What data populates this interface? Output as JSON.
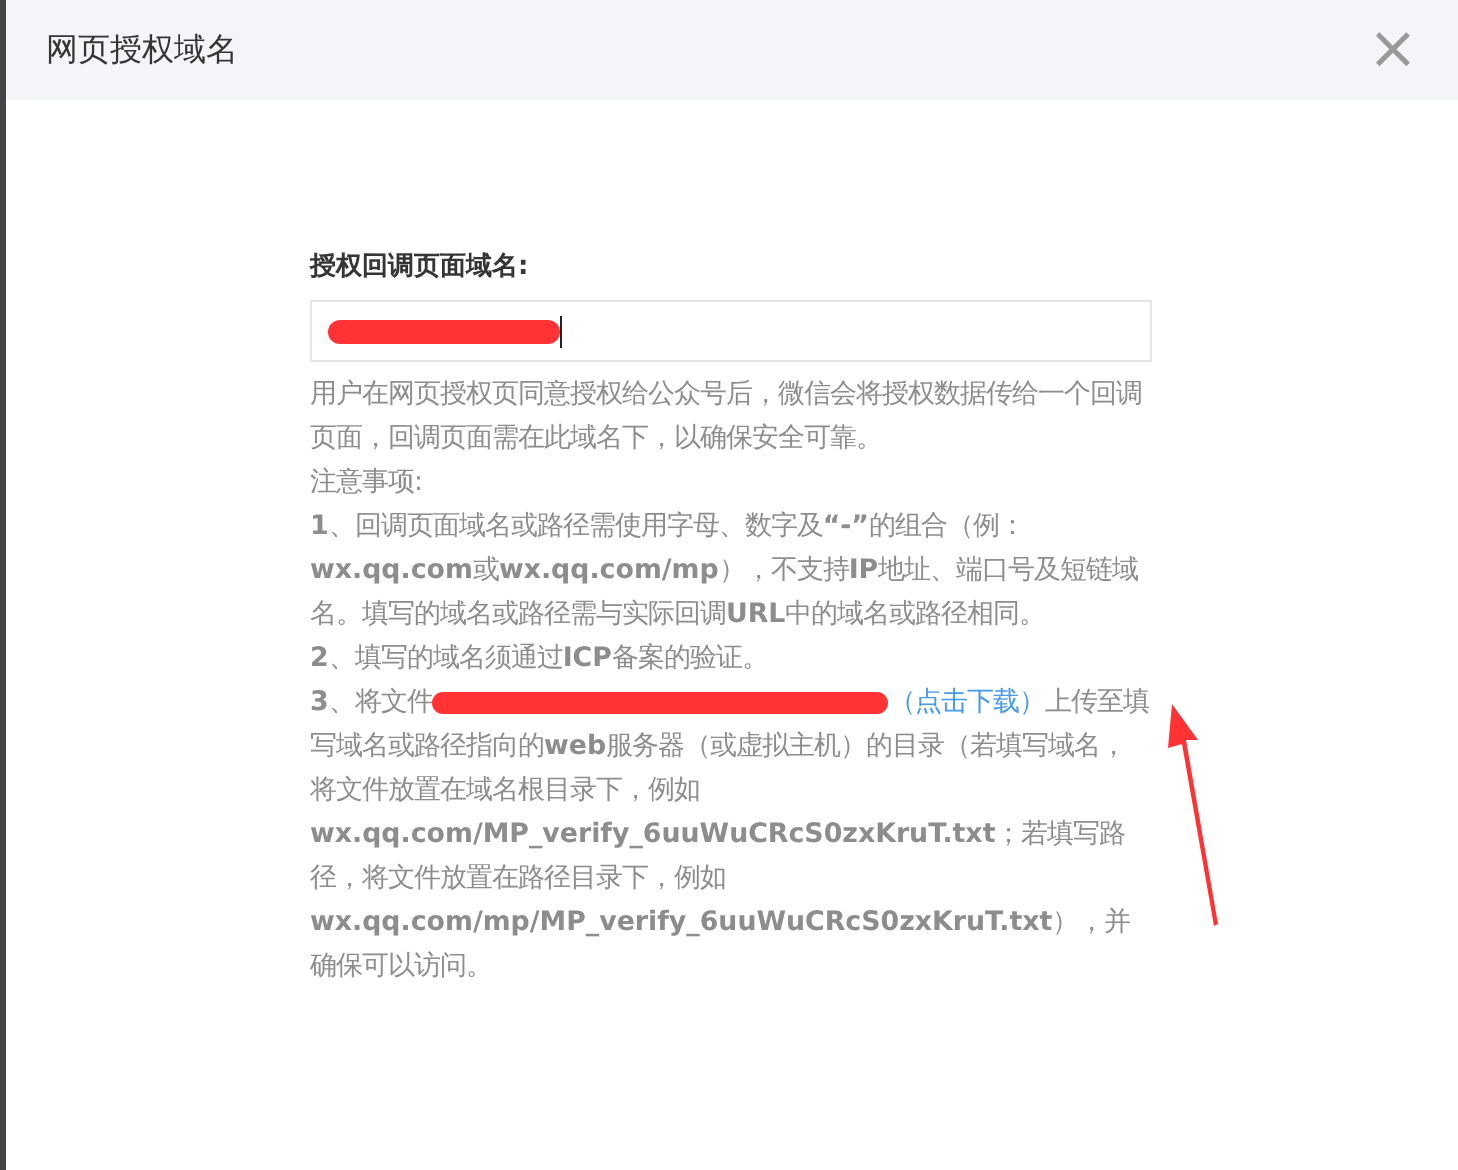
{
  "dialog": {
    "title": "网页授权域名",
    "close": "×"
  },
  "form": {
    "label": "授权回调页面域名:",
    "field": {
      "redacted": true
    }
  },
  "description": "用户在网页授权页同意授权给公众号后，微信会将授权数据传给一个回调页面，回调页面需在此域名下，以确保安全可靠。",
  "notes_title": "注意事项:",
  "notes": [
    {
      "kind": "text",
      "text": "**1**、回调页面域名或路径需使用字母、数字及**“-”**的组合（例：**wx.qq.com**或**wx.qq.com/mp**），不支持**IP**地址、端口号及短链域名。填写的域名或路径需与实际回调**URL**中的域名或路径相同。"
    },
    {
      "kind": "text",
      "text": "**2**、填写的域名须通过**ICP**备案的验证。"
    },
    {
      "kind": "file",
      "before": "**3**、将文件",
      "redacted": true,
      "link": "（点击下载）",
      "after": "上传至填写域名或路径指向的**web**服务器（或虚拟主机）的目录（若填写域名，将文件放置在域名根目录下，例如**wx.qq.com/MP_verify_6uuWuCRcS0zxKruT.txt**；若填写路径，将文件放置在路径目录下，例如**wx.qq.com/mp/MP_verify_6uuWuCRcS0zxKruT.txt**），并确保可以访问。"
    }
  ]
}
